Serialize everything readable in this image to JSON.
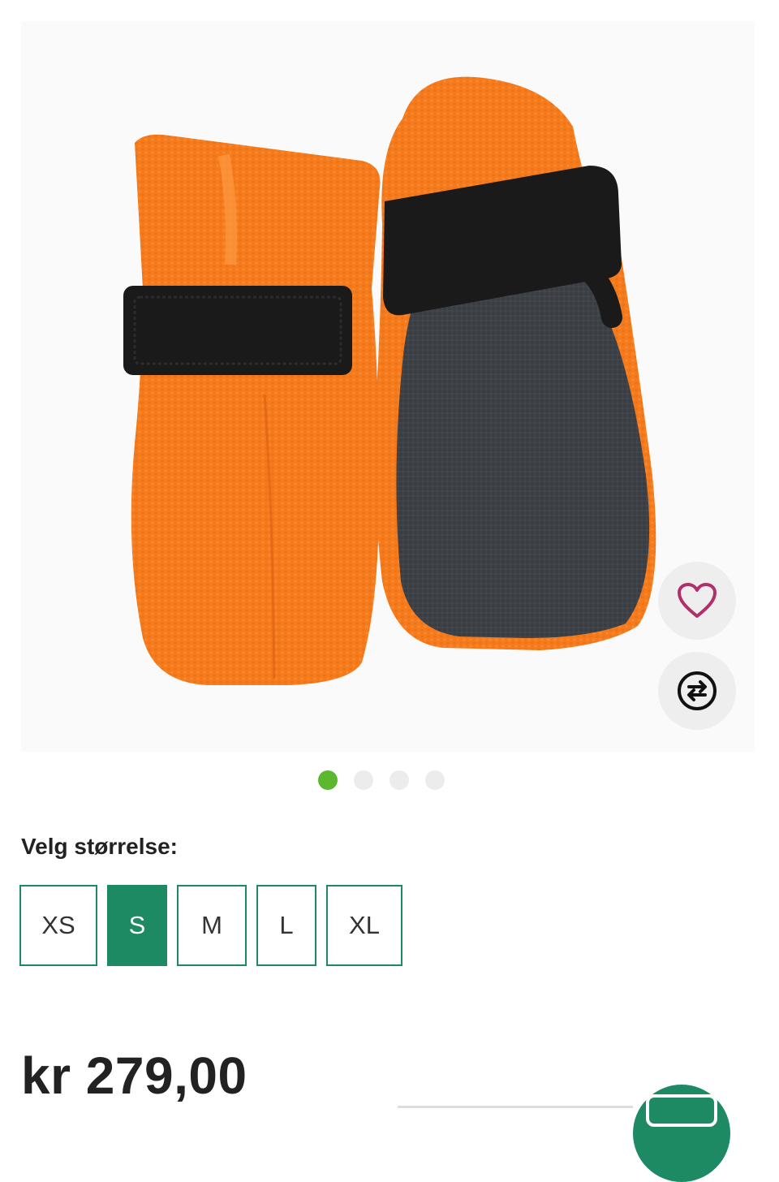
{
  "product": {
    "image_alt": "Orange fleece dog boots with black velcro straps",
    "gallery": {
      "total_images": 4,
      "active_index": 0
    }
  },
  "actions": {
    "favorite_icon": "heart-icon",
    "compare_icon": "compare-arrows-icon",
    "cart_icon": "cart-icon"
  },
  "size_selector": {
    "label": "Velg størrelse:",
    "options": [
      "XS",
      "S",
      "M",
      "L",
      "XL"
    ],
    "selected": "S"
  },
  "price": {
    "text": "kr 279,00"
  },
  "colors": {
    "accent_green": "#1e8a64",
    "dot_active": "#5cb82e",
    "heart": "#b0306a",
    "product_orange": "#f57a1c",
    "strap_black": "#1a1a1a",
    "sole_gray": "#3a3d42"
  }
}
